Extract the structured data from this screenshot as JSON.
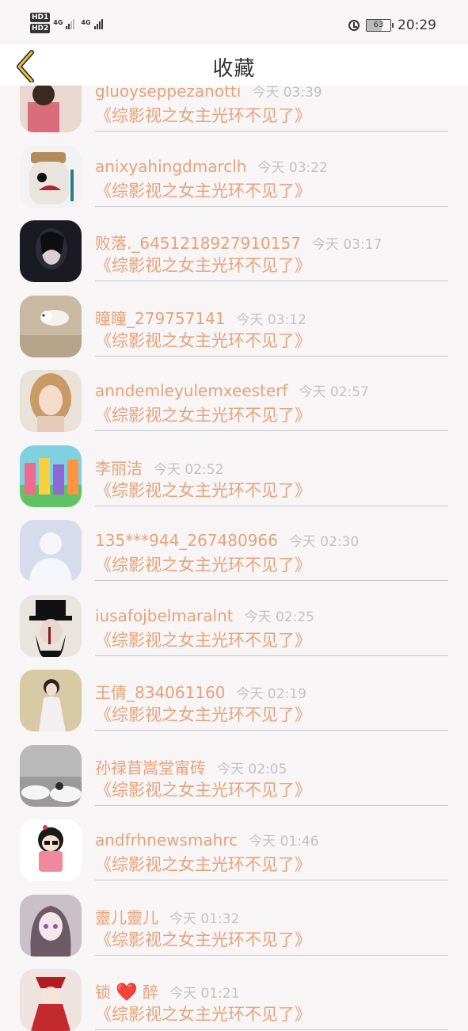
{
  "status_bar": {
    "hd1": "HD1",
    "hd2": "HD2",
    "net1": "4G",
    "net2": "4G",
    "battery": "63",
    "time": "20:29"
  },
  "header": {
    "title": "收藏",
    "back_icon": "chevron-left-icon"
  },
  "items": [
    {
      "name": "gluoyseppezanotti",
      "time": "今天 03:39",
      "book": "《综影视之女主光环不见了》",
      "avatar": "photo-woman-pink"
    },
    {
      "name": "anixyahingdmarclh",
      "time": "今天 03:22",
      "book": "《综影视之女主光环不见了》",
      "avatar": "jar-face"
    },
    {
      "name": "败落._6451218927910157",
      "time": "今天 03:17",
      "book": "《综影视之女主光环不见了》",
      "avatar": "dark-portrait"
    },
    {
      "name": "瞳瞳_279757141",
      "time": "今天 03:12",
      "book": "《综影视之女主光环不见了》",
      "avatar": "puppy"
    },
    {
      "name": "anndemleyulemxeesterf",
      "time": "今天 02:57",
      "book": "《综影视之女主光环不见了》",
      "avatar": "blonde-woman"
    },
    {
      "name": "李丽洁",
      "time": "今天 02:52",
      "book": "《综影视之女主光环不见了》",
      "avatar": "colorful-toys"
    },
    {
      "name": "135***944_267480966",
      "time": "今天 02:30",
      "book": "《综影视之女主光环不见了》",
      "avatar": "default-user"
    },
    {
      "name": "iusafojbelmaralnt",
      "time": "今天 02:25",
      "book": "《综影视之女主光环不见了》",
      "avatar": "top-hat"
    },
    {
      "name": "王倩_834061160",
      "time": "今天 02:19",
      "book": "《综影视之女主光环不见了》",
      "avatar": "white-dress"
    },
    {
      "name": "孙禄苜嵩堂甯砖",
      "time": "今天 02:05",
      "book": "《综影视之女主光环不见了》",
      "avatar": "clouds"
    },
    {
      "name": "andfrhnewsmahrc",
      "time": "今天 01:46",
      "book": "《综影视之女主光环不见了》",
      "avatar": "cartoon-girl"
    },
    {
      "name": "靈儿靈儿",
      "time": "今天 01:32",
      "book": "《综影视之女主光环不见了》",
      "avatar": "anime-girl"
    },
    {
      "name_pre": "锁",
      "name_heart": "❤️",
      "name_post": "醉",
      "time": "今天 01:21",
      "book": "《综影视之女主光环不见了》",
      "avatar": "red-costume"
    }
  ],
  "colors": {
    "accent": "#e8a277",
    "time": "#c2c2c2",
    "divider": "#c9c9c9",
    "background": "#f7f5f6"
  }
}
